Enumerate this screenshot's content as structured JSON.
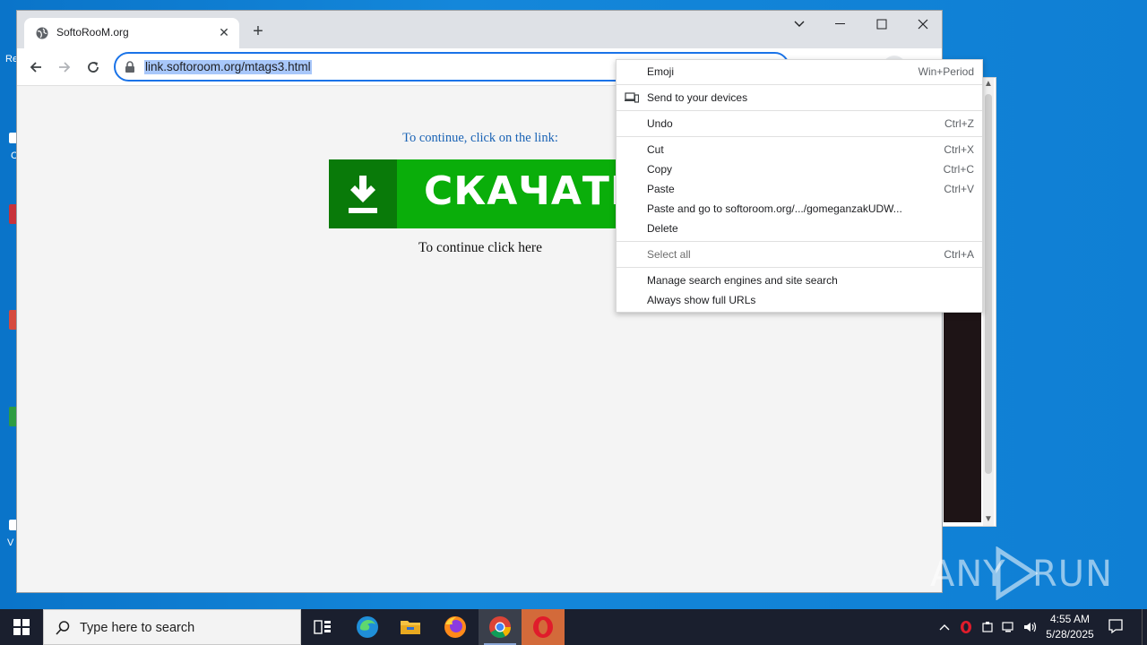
{
  "desktop": {
    "fragments": [
      "Re",
      "C",
      "V"
    ]
  },
  "browser": {
    "tab": {
      "title": "SoftoRooM.org"
    },
    "url": "link.softoroom.org/mtags3.html",
    "window_controls": [
      "chevron-down",
      "minimize",
      "maximize",
      "close"
    ]
  },
  "page": {
    "continue_link_text": "To continue, click on the link:",
    "download_button_text": "СКАЧАТЬ",
    "continue_click_text": "To continue click here",
    "colors": {
      "button_green": "#0aae0a",
      "button_dark_green": "#097a09",
      "link_blue": "#1a63b5"
    }
  },
  "context_menu": {
    "items": [
      {
        "label": "Emoji",
        "shortcut": "Win+Period"
      },
      {
        "label": "Send to your devices",
        "shortcut": "",
        "icon": "devices-icon"
      },
      {
        "label": "Undo",
        "shortcut": "Ctrl+Z"
      },
      {
        "label": "Cut",
        "shortcut": "Ctrl+X"
      },
      {
        "label": "Copy",
        "shortcut": "Ctrl+C"
      },
      {
        "label": "Paste",
        "shortcut": "Ctrl+V"
      },
      {
        "label": "Paste and go to softoroom.org/.../gomeganzakUDW...",
        "shortcut": ""
      },
      {
        "label": "Delete",
        "shortcut": ""
      },
      {
        "label": "Select all",
        "shortcut": "Ctrl+A"
      },
      {
        "label": "Manage search engines and site search",
        "shortcut": ""
      },
      {
        "label": "Always show full URLs",
        "shortcut": ""
      }
    ]
  },
  "watermark": {
    "left": "ANY",
    "right": "RUN"
  },
  "taskbar": {
    "search_placeholder": "Type here to search",
    "apps": [
      "task-view",
      "edge",
      "file-explorer",
      "firefox",
      "chrome",
      "opera"
    ],
    "clock": {
      "time": "4:55 AM",
      "date": "5/28/2025"
    }
  }
}
